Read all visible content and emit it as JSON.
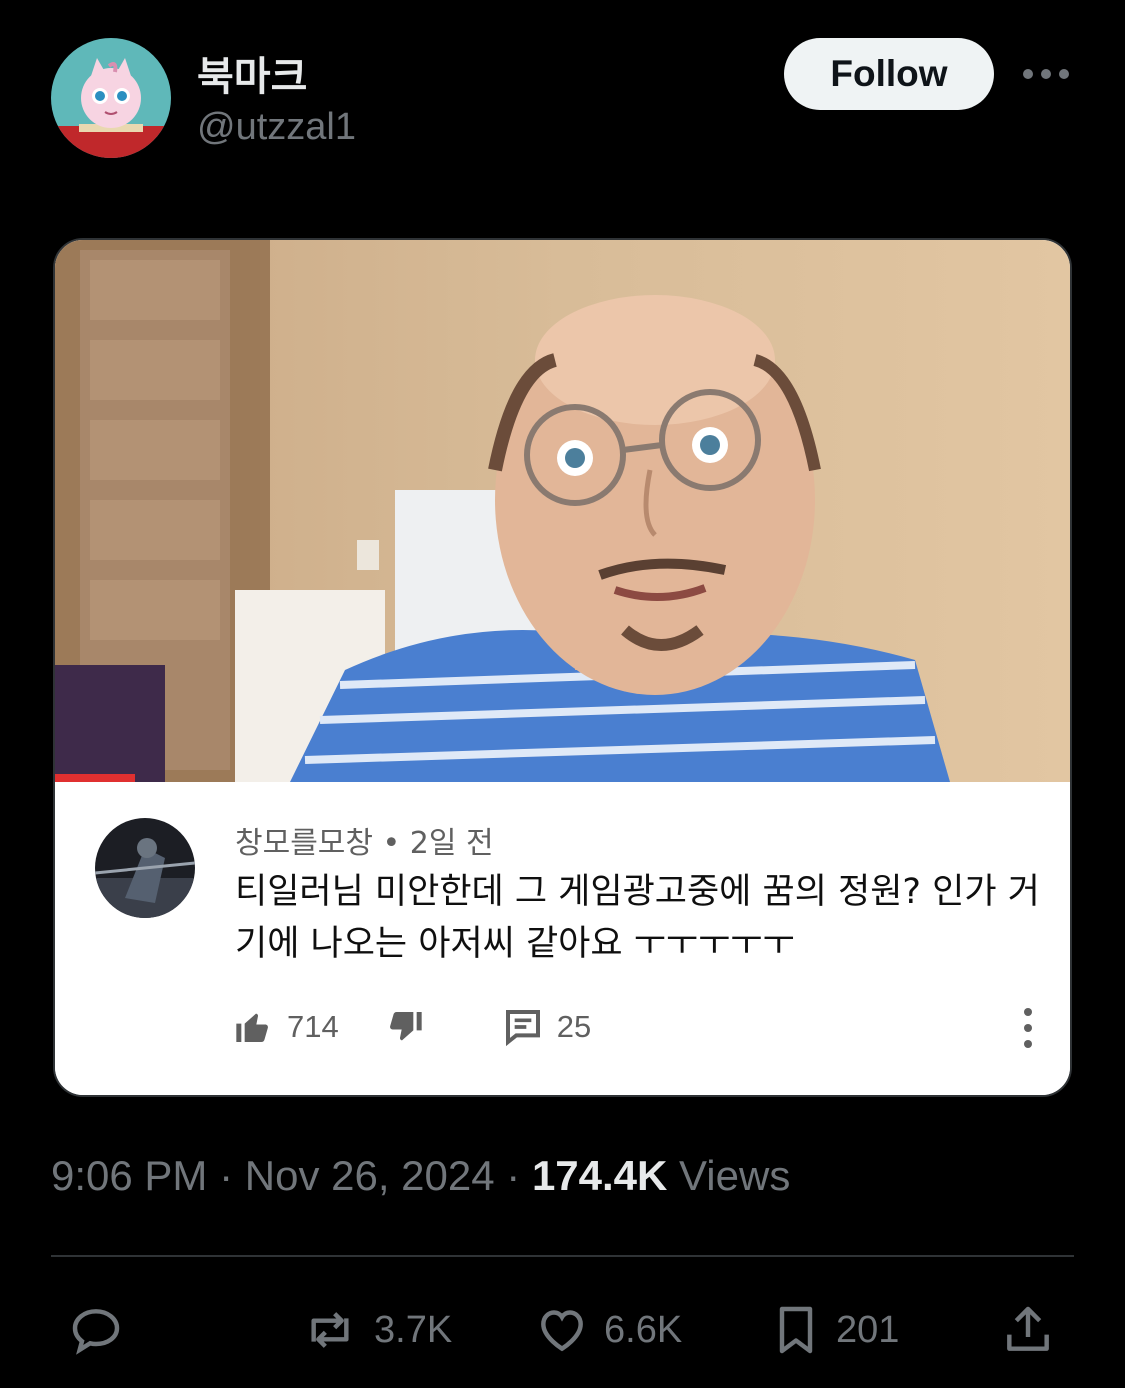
{
  "author": {
    "display_name": "북마크",
    "handle": "@utzzal1",
    "avatar_icon": "jigglypuff-avatar"
  },
  "follow_label": "Follow",
  "more_icon": "more-horizontal-icon",
  "embedded_comment": {
    "username": "창모를모창",
    "time_ago": "2일 전",
    "meta_separator": " • ",
    "text": "티일러님 미안한데 그 게임광고중에 꿈의 정원? 인가 거기에 나오는 아저씨 같아요 ㅜㅜㅜㅜㅜ",
    "likes": "714",
    "replies": "25"
  },
  "timestamp": {
    "time": "9:06 PM",
    "date": "Nov 26, 2024",
    "separator": " · ",
    "views_count": "174.4K",
    "views_label": "Views"
  },
  "actions": {
    "reply_icon": "reply-icon",
    "reposts": "3.7K",
    "likes": "6.6K",
    "bookmarks": "201",
    "share_icon": "share-icon"
  },
  "colors": {
    "background": "#000000",
    "primary_text": "#e7e9ea",
    "secondary_text": "#71767b",
    "follow_bg": "#eff3f4",
    "divider": "#2f3336"
  }
}
